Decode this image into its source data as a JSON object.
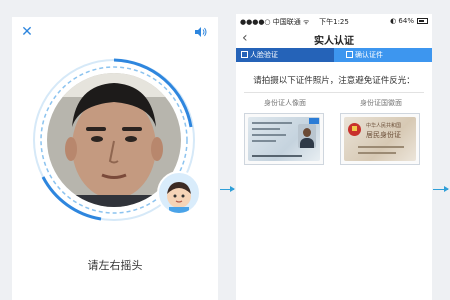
{
  "face_screen": {
    "instruction": "请左右摇头"
  },
  "verify_screen": {
    "status_bar": {
      "carrier": "●●●●○ 中国联通 ᯤ",
      "time": "下午1:25",
      "battery": "◐ 64%"
    },
    "title": "实人认证",
    "steps": [
      {
        "label": "人脸验证"
      },
      {
        "label": "确认证件"
      }
    ],
    "hint": "请拍摄以下证件照片，注意避免证件反光：",
    "cards": [
      {
        "label": "身份证人像面"
      },
      {
        "label": "身份证国徽面"
      }
    ],
    "card_back_title": "居民身份证",
    "card_back_country": "中华人民共和国"
  },
  "colors": {
    "accent": "#2e86de",
    "step_active": "#2563b8",
    "step_next": "#3d96ef",
    "arrow": "#2f9fd8"
  }
}
